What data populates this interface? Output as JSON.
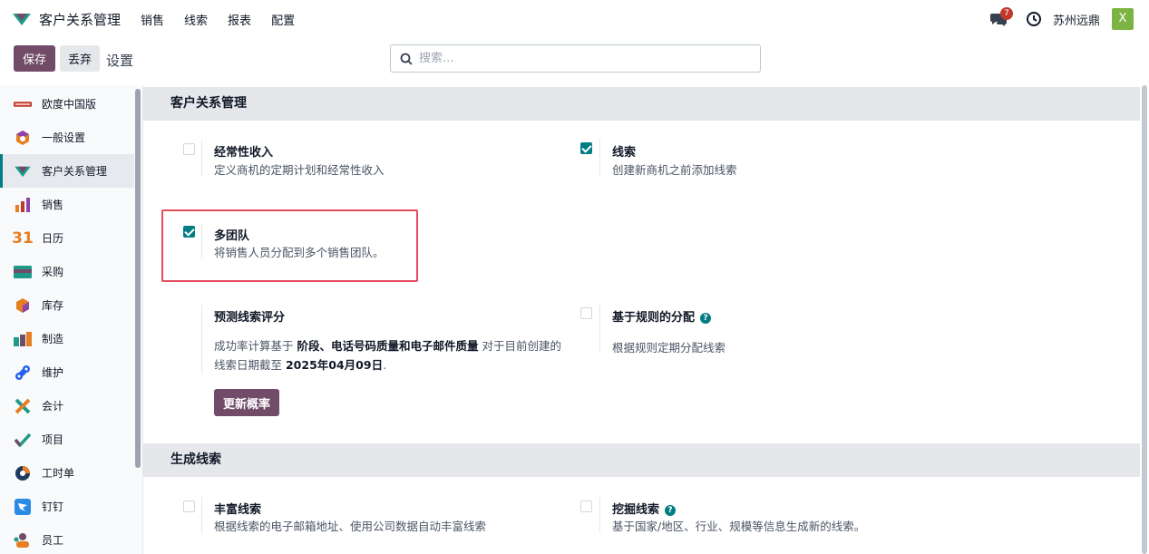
{
  "app": {
    "title": "客户关系管理",
    "menu": [
      "销售",
      "线索",
      "报表",
      "配置"
    ],
    "notification_count": "7",
    "company": "苏州远鼎",
    "avatar_letter": "X",
    "brand_color": "#714b67",
    "accent_color": "#017e84"
  },
  "control_panel": {
    "save_label": "保存",
    "discard_label": "丢弃",
    "title": "设置",
    "search_placeholder": "搜索..."
  },
  "sidebar": {
    "items": [
      {
        "label": "欧度中国版",
        "icon": "odoo-china-logo-icon"
      },
      {
        "label": "一般设置",
        "icon": "settings-app-icon"
      },
      {
        "label": "客户关系管理",
        "icon": "crm-app-icon",
        "active": true
      },
      {
        "label": "销售",
        "icon": "sales-app-icon"
      },
      {
        "label": "日历",
        "icon": "calendar-app-icon"
      },
      {
        "label": "采购",
        "icon": "purchase-app-icon"
      },
      {
        "label": "库存",
        "icon": "inventory-app-icon"
      },
      {
        "label": "制造",
        "icon": "manufacturing-app-icon"
      },
      {
        "label": "维护",
        "icon": "maintenance-app-icon"
      },
      {
        "label": "会计",
        "icon": "accounting-app-icon"
      },
      {
        "label": "项目",
        "icon": "project-app-icon"
      },
      {
        "label": "工时单",
        "icon": "timesheet-app-icon"
      },
      {
        "label": "钉钉",
        "icon": "dingtalk-app-icon"
      },
      {
        "label": "员工",
        "icon": "employees-app-icon"
      }
    ],
    "calendar_icon_text": "31"
  },
  "sections": {
    "crm": {
      "title": "客户关系管理",
      "recurring_revenue": {
        "title": "经常性收入",
        "desc": "定义商机的定期计划和经常性收入",
        "checked": false
      },
      "leads": {
        "title": "线索",
        "desc": "创建新商机之前添加线索",
        "checked": true
      },
      "multi_teams": {
        "title": "多团队",
        "desc": "将销售人员分配到多个销售团队。",
        "checked": true
      },
      "predictive": {
        "title": "预测线索评分",
        "text_prefix": "成功率计算基于 ",
        "text_bold": "阶段、电话号码质量和电子邮件质量",
        "text_mid": " 对于目前创建的线索日期截至 ",
        "text_date": "2025年04月09日",
        "text_end": ".",
        "button": "更新概率"
      },
      "rule_based": {
        "title": "基于规则的分配",
        "desc": "根据规则定期分配线索",
        "checked": false,
        "help": "?"
      }
    },
    "lead_gen": {
      "title": "生成线索",
      "enrich": {
        "title": "丰富线索",
        "desc": "根据线索的电子邮箱地址、使用公司数据自动丰富线索",
        "checked": false
      },
      "mining": {
        "title": "挖掘线索",
        "desc": "基于国家/地区、行业、规模等信息生成新的线索。",
        "checked": false,
        "help": "?"
      }
    }
  }
}
